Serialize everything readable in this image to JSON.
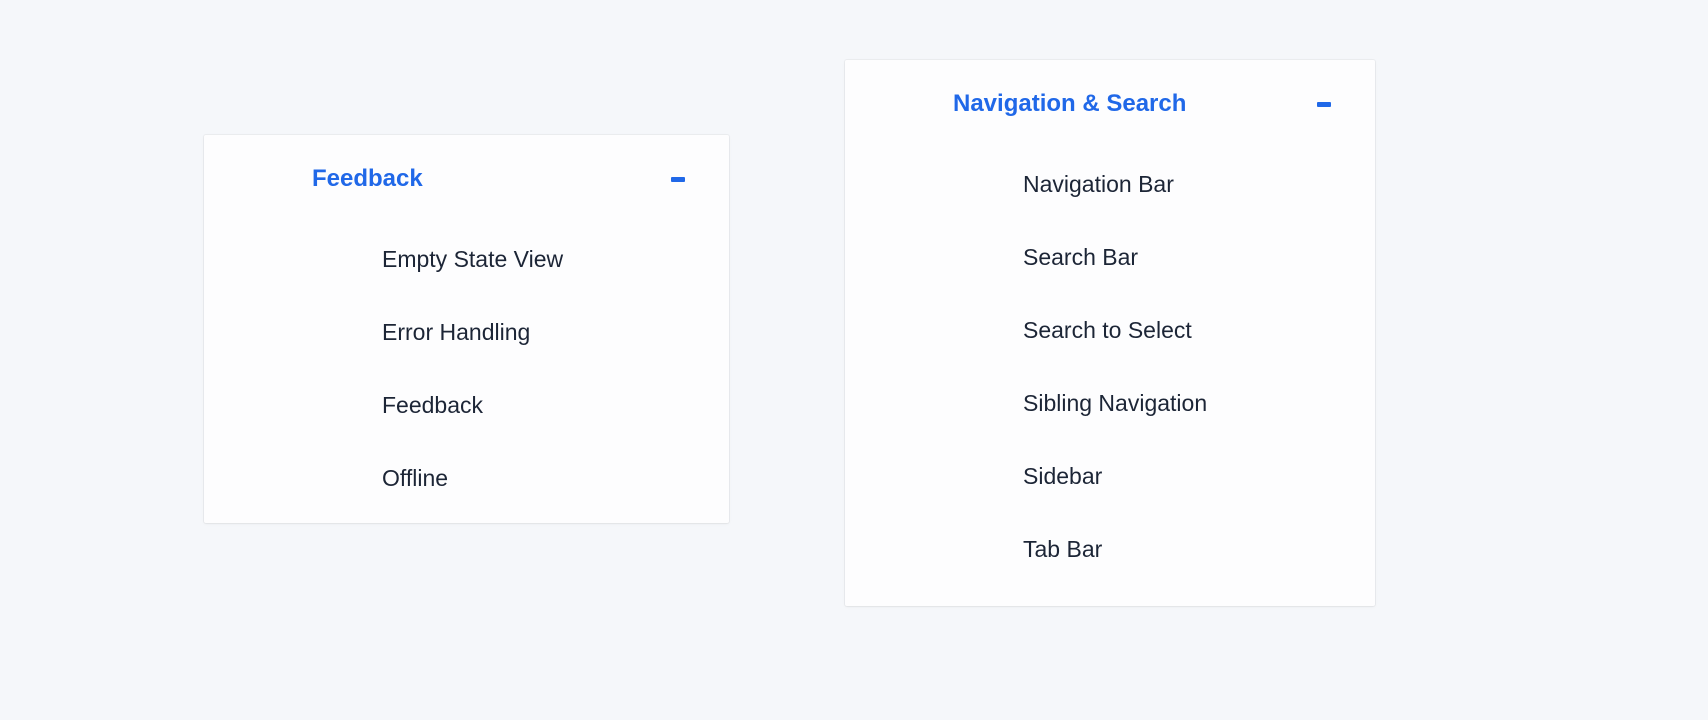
{
  "panels": [
    {
      "title": "Feedback",
      "items": [
        "Empty State View",
        "Error Handling",
        "Feedback",
        "Offline"
      ]
    },
    {
      "title": "Navigation & Search",
      "items": [
        "Navigation Bar",
        "Search Bar",
        "Search to Select",
        "Sibling Navigation",
        "Sidebar",
        "Tab Bar"
      ]
    }
  ]
}
